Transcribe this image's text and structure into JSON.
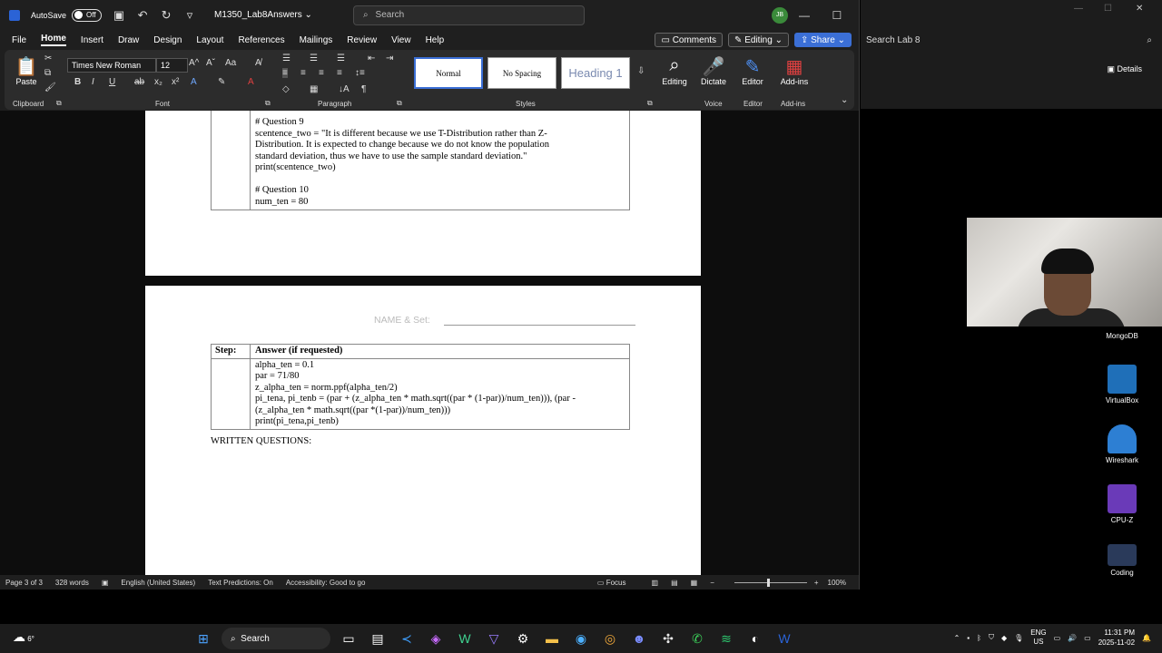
{
  "titlebar": {
    "autosave_label": "AutoSave",
    "autosave_state": "Off",
    "doc_title": "M1350_Lab8Answers",
    "search_placeholder": "Search",
    "avatar_initials": "JB"
  },
  "menubar": {
    "tabs": [
      "File",
      "Home",
      "Insert",
      "Draw",
      "Design",
      "Layout",
      "References",
      "Mailings",
      "Review",
      "View",
      "Help"
    ],
    "active": "Home",
    "comments_label": "Comments",
    "editing_label": "Editing",
    "share_label": "Share"
  },
  "ribbon": {
    "paste_label": "Paste",
    "font_name": "Times New Roman",
    "font_size": "12",
    "styles": [
      "Normal",
      "No Spacing",
      "Heading 1"
    ],
    "editing_btn": "Editing",
    "dictate_btn": "Dictate",
    "editor_btn": "Editor",
    "addins_btn": "Add-ins",
    "groups": {
      "clipboard": "Clipboard",
      "font": "Font",
      "paragraph": "Paragraph",
      "styles": "Styles",
      "voice": "Voice",
      "editor": "Editor",
      "addins": "Add-ins"
    }
  },
  "page1": {
    "lines": [
      "# Question 9",
      "scentence_two = \"It is different because we use T-Distribution rather than Z-",
      "Distribution. It is expected to change because we do not know the population",
      "standard deviation, thus we have to use the sample standard deviation.\"",
      "print(scentence_two)",
      "",
      "# Question 10",
      "num_ten = 80"
    ]
  },
  "page2": {
    "name_set": "NAME & Set:",
    "col_step": "Step:",
    "col_answer": "Answer (if requested)",
    "lines": [
      "alpha_ten = 0.1",
      "par = 71/80",
      "z_alpha_ten = norm.ppf(alpha_ten/2)",
      "pi_tena, pi_tenb = (par + (z_alpha_ten * math.sqrt((par * (1-par))/num_ten))), (par -",
      "(z_alpha_ten * math.sqrt((par *(1-par))/num_ten)))",
      "print(pi_tena,pi_tenb)"
    ],
    "written": "WRITTEN QUESTIONS:"
  },
  "statusbar": {
    "page": "Page 3 of 3",
    "words": "328 words",
    "language": "English (United States)",
    "predictions": "Text Predictions: On",
    "accessibility": "Accessibility: Good to go",
    "focus": "Focus",
    "zoom": "100%"
  },
  "right_pane": {
    "search": "Search Lab 8",
    "details": "Details"
  },
  "desktop": {
    "icons": [
      "MongoDB",
      "VirtualBox",
      "Wireshark",
      "CPU-Z",
      "Coding"
    ]
  },
  "taskbar": {
    "temp": "6°",
    "search": "Search",
    "lang1": "ENG",
    "lang2": "US",
    "time": "11:31 PM",
    "date": "2025-11-02"
  },
  "colors": {
    "accent": "#3b6fd6",
    "word_blue": "#2b63d6"
  }
}
